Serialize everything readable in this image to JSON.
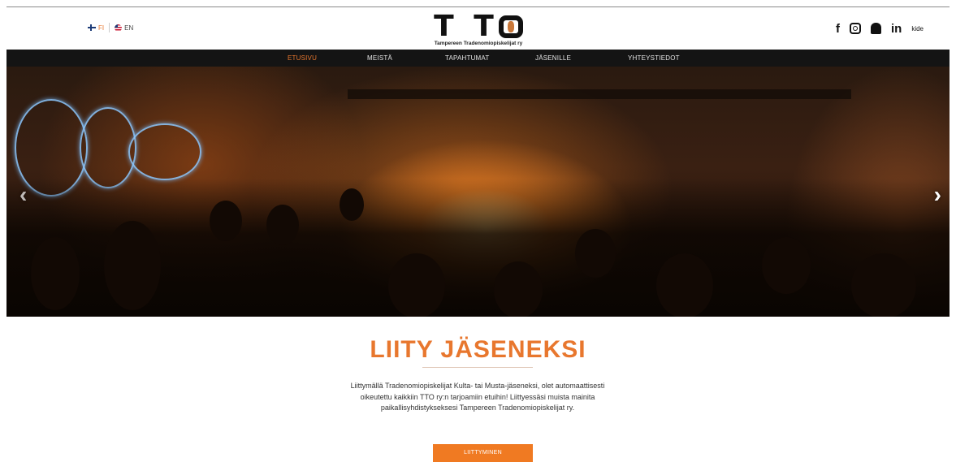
{
  "header": {
    "lang": {
      "fi_label": "FI",
      "en_label": "EN"
    },
    "logo": {
      "letters": "TTO",
      "subtitle": "Tampereen Tradenomiopiskelijat ry"
    },
    "social": {
      "facebook": "f",
      "linkedin": "in",
      "kide": "kide"
    }
  },
  "nav": {
    "items": [
      {
        "label": "ETUSIVU",
        "active": true
      },
      {
        "label": "MEISTÄ",
        "active": false
      },
      {
        "label": "TAPAHTUMAT",
        "active": false
      },
      {
        "label": "JÄSENILLE",
        "active": false
      },
      {
        "label": "YHTEYSTIEDOT",
        "active": false
      }
    ]
  },
  "hero": {
    "prev_arrow": "‹",
    "next_arrow": "›"
  },
  "join": {
    "title": "LIITY JÄSENEKSI",
    "text": "Liittymällä Tradenomiopiskelijat Kulta- tai Musta-jäseneksi, olet automaattisesti oikeutettu kaikkiin TTO ry:n tarjoamiin etuihin! Liittyessäsi muista mainita paikallisyhdistykseksesi Tampereen Tradenomiopiskelijat ry.",
    "button": "LIITTYMINEN"
  },
  "colors": {
    "accent": "#e8772e",
    "nav_bg": "#141414",
    "button": "#f07a22"
  },
  "icons": [
    "finland-flag-icon",
    "uk-flag-icon",
    "facebook-icon",
    "instagram-icon",
    "snapchat-icon",
    "linkedin-icon",
    "kide-icon",
    "chevron-left-icon",
    "chevron-right-icon"
  ]
}
